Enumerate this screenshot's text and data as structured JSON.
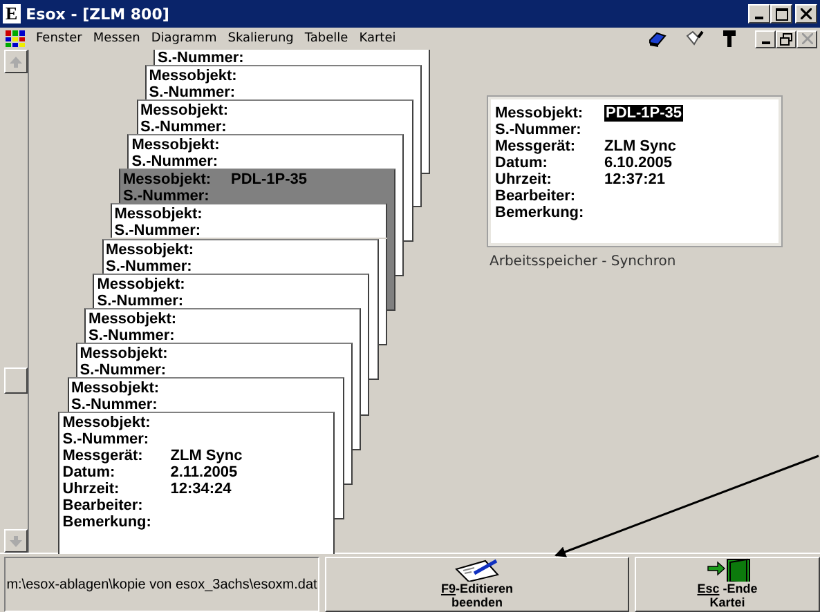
{
  "window": {
    "logo_letter": "E",
    "title": "Esox - [ZLM 800]"
  },
  "menu": [
    "Fenster",
    "Messen",
    "Diagramm",
    "Skalierung",
    "Tabelle",
    "Kartei"
  ],
  "cards": [
    {
      "selected": false,
      "fields": [
        {
          "label": "S.-Nummer:"
        }
      ]
    },
    {
      "selected": false,
      "fields": [
        {
          "label": "Messobjekt:"
        },
        {
          "label": "S.-Nummer:"
        }
      ]
    },
    {
      "selected": false,
      "fields": [
        {
          "label": "Messobjekt:"
        },
        {
          "label": "S.-Nummer:"
        }
      ]
    },
    {
      "selected": false,
      "fields": [
        {
          "label": "Messobjekt:"
        },
        {
          "label": "S.-Nummer:"
        }
      ]
    },
    {
      "selected": true,
      "fields": [
        {
          "label": "Messobjekt:",
          "value": "PDL-1P-35"
        },
        {
          "label": "S.-Nummer:"
        }
      ]
    },
    {
      "selected": false,
      "fields": [
        {
          "label": "Messobjekt:"
        },
        {
          "label": "S.-Nummer:"
        }
      ]
    },
    {
      "selected": false,
      "fields": [
        {
          "label": "Messobjekt:"
        },
        {
          "label": "S.-Nummer:"
        }
      ]
    },
    {
      "selected": false,
      "fields": [
        {
          "label": "Messobjekt:"
        },
        {
          "label": "S.-Nummer:"
        }
      ]
    },
    {
      "selected": false,
      "fields": [
        {
          "label": "Messobjekt:"
        },
        {
          "label": "S.-Nummer:"
        }
      ]
    },
    {
      "selected": false,
      "fields": [
        {
          "label": "Messobjekt:"
        },
        {
          "label": "S.-Nummer:"
        }
      ]
    },
    {
      "selected": false,
      "fields": [
        {
          "label": "Messobjekt:"
        },
        {
          "label": "S.-Nummer:"
        }
      ]
    },
    {
      "selected": false,
      "fields": [
        {
          "label": "Messobjekt:"
        },
        {
          "label": "S.-Nummer:"
        },
        {
          "label": "Messgerät:",
          "value": "ZLM Sync"
        },
        {
          "label": "Datum:",
          "value": "2.11.2005"
        },
        {
          "label": "Uhrzeit:",
          "value": "12:34:24"
        },
        {
          "label": "Bearbeiter:"
        },
        {
          "label": "Bemerkung:"
        }
      ]
    }
  ],
  "detail": {
    "fields": [
      {
        "label": "Messobjekt:",
        "value": "PDL-1P-35",
        "highlighted": true
      },
      {
        "label": "S.-Nummer:"
      },
      {
        "label": "Messgerät:",
        "value": "ZLM Sync",
        "highlighted": false
      },
      {
        "label": "Datum:",
        "value": "6.10.2005",
        "highlighted": false
      },
      {
        "label": "Uhrzeit:",
        "value": "12:37:21",
        "highlighted": false
      },
      {
        "label": "Bearbeiter:"
      },
      {
        "label": "Bemerkung:"
      }
    ],
    "caption": "Arbeitsspeicher - Synchron"
  },
  "status_bar": {
    "path": "m:\\esox-ablagen\\kopie von esox_3achs\\esoxm.dat",
    "buttons": [
      {
        "kind": "edit",
        "key": "F9",
        "label": "-Editieren",
        "line2": "beenden"
      },
      {
        "kind": "exit",
        "key": "Esc",
        "label": " -Ende",
        "line2": "Kartei"
      }
    ]
  }
}
